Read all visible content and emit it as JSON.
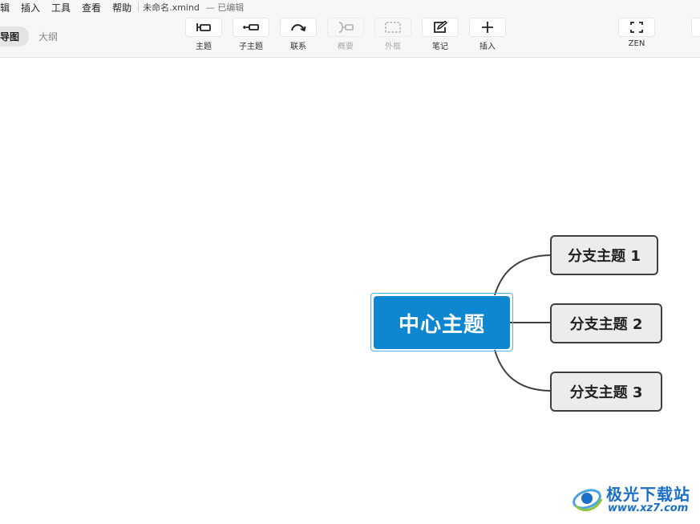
{
  "menu": {
    "items": [
      "编辑",
      "插入",
      "工具",
      "查看",
      "帮助"
    ],
    "document_title": "未命名.xmind",
    "document_status": "— 已编辑"
  },
  "view_switcher": {
    "tabs": [
      "导图",
      "大纲"
    ],
    "active": "导图"
  },
  "toolbar": {
    "tools": [
      {
        "label": "主题",
        "icon": "topic-icon",
        "enabled": true
      },
      {
        "label": "子主题",
        "icon": "subtopic-icon",
        "enabled": true
      },
      {
        "label": "联系",
        "icon": "relationship-icon",
        "enabled": true
      },
      {
        "label": "概要",
        "icon": "summary-icon",
        "enabled": false
      },
      {
        "label": "外框",
        "icon": "boundary-icon",
        "enabled": false
      },
      {
        "label": "笔记",
        "icon": "note-icon",
        "enabled": true
      },
      {
        "label": "插入",
        "icon": "plus-icon",
        "enabled": true
      }
    ],
    "zen_label": "ZEN"
  },
  "mindmap": {
    "central_topic": "中心主题",
    "branches": [
      "分支主题 1",
      "分支主题 2",
      "分支主题 3"
    ],
    "colors": {
      "central_fill": "#0f86d0",
      "central_selection": "#4fb3e8",
      "branch_fill": "#ececec",
      "branch_border": "#3f3f3f",
      "connector": "#3f3f3f"
    }
  },
  "watermark": {
    "title": "极光下载站",
    "url": "www.xz7.com",
    "color": "#1b6fc4"
  }
}
